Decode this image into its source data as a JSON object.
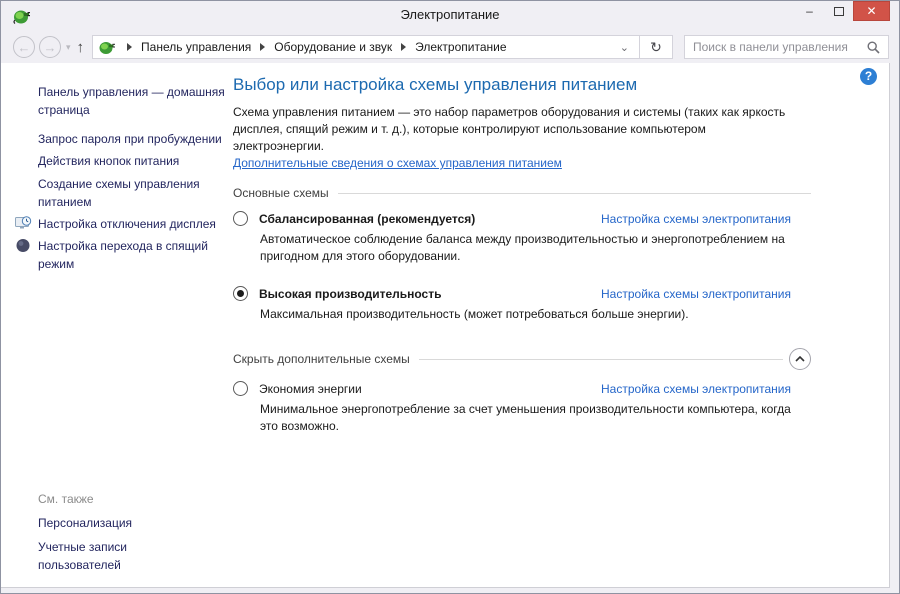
{
  "window": {
    "title": "Электропитание"
  },
  "navbar": {
    "back_glyph": "←",
    "forward_glyph": "→",
    "history_dropdown_glyph": "▾",
    "up_glyph": "↑",
    "breadcrumb": [
      "Панель управления",
      "Оборудование и звук",
      "Электропитание"
    ],
    "address_dropdown_glyph": "⌄",
    "refresh_glyph": "↻",
    "search_placeholder": "Поиск в панели управления"
  },
  "sidebar": {
    "items": [
      {
        "label": "Панель управления — домашняя страница",
        "icon": "none"
      },
      {
        "label": "Запрос пароля при пробуждении",
        "icon": "none"
      },
      {
        "label": "Действия кнопок питания",
        "icon": "none"
      },
      {
        "label": "Создание схемы управления питанием",
        "icon": "none"
      },
      {
        "label": "Настройка отключения дисплея",
        "icon": "display-clock-icon"
      },
      {
        "label": "Настройка перехода в спящий режим",
        "icon": "sleep-icon"
      }
    ],
    "see_also_header": "См. также",
    "see_also_items": [
      {
        "label": "Персонализация"
      },
      {
        "label": "Учетные записи пользователей"
      }
    ]
  },
  "main": {
    "help_glyph": "?",
    "title": "Выбор или настройка схемы управления питанием",
    "intro": "Схема управления питанием — это набор параметров оборудования и системы (таких как яркость дисплея, спящий режим и т. д.), которые контролируют использование компьютером электроэнергии.",
    "learn_more_link": "Дополнительные сведения о схемах управления питанием",
    "primary_section_label": "Основные схемы",
    "additional_section_label": "Скрыть дополнительные схемы",
    "plans": [
      {
        "name": "Сбалансированная (рекомендуется)",
        "name_bold": true,
        "checked": false,
        "desc": "Автоматическое соблюдение баланса между производительностью и энергопотреблением на пригодном для этого оборудовании.",
        "link": "Настройка схемы электропитания"
      },
      {
        "name": "Высокая производительность",
        "name_bold": true,
        "checked": true,
        "desc": "Максимальная производительность (может потребоваться больше энергии).",
        "link": "Настройка схемы электропитания"
      },
      {
        "name": "Экономия энергии",
        "name_bold": false,
        "checked": false,
        "desc": "Минимальное энергопотребление за счет уменьшения производительности компьютера, когда это возможно.",
        "link": "Настройка схемы электропитания"
      }
    ]
  },
  "colors": {
    "chrome_bg": "#f0eff4",
    "close_button": "#d15348",
    "heading_blue": "#1d6ab0",
    "link_blue": "#2566c9",
    "sidebar_link": "#23265f",
    "muted_gray": "#8b8b8b"
  }
}
